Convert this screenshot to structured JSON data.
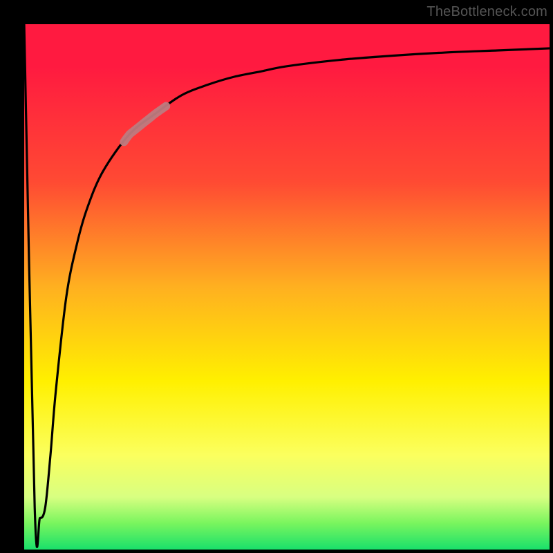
{
  "watermark": "TheBottleneck.com",
  "chart_data": {
    "type": "line",
    "title": "",
    "xlabel": "",
    "ylabel": "",
    "xlim": [
      0,
      100
    ],
    "ylim": [
      0,
      100
    ],
    "highlight_segment": {
      "x_start": 19,
      "x_end": 27
    },
    "series": [
      {
        "name": "curve",
        "x": [
          0,
          2,
          3,
          4,
          5,
          6,
          8,
          10,
          12,
          15,
          20,
          25,
          30,
          35,
          40,
          45,
          50,
          60,
          70,
          80,
          90,
          100
        ],
        "y": [
          100,
          8,
          6,
          8,
          18,
          30,
          48,
          58,
          65,
          72,
          79,
          83,
          86.5,
          88.5,
          90,
          91,
          92,
          93.2,
          94,
          94.6,
          95,
          95.4
        ]
      }
    ]
  }
}
